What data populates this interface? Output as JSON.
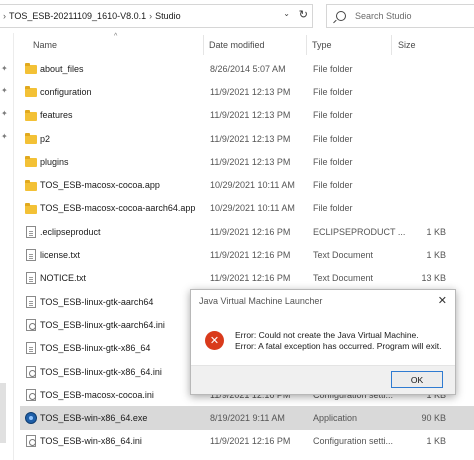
{
  "address": {
    "crumbs": [
      "TOS_ESB-20211109_1610-V8.0.1",
      "Studio"
    ],
    "search_placeholder": "Search Studio"
  },
  "columns": {
    "name": "Name",
    "date": "Date modified",
    "type": "Type",
    "size": "Size"
  },
  "files": [
    {
      "name": "about_files",
      "date": "8/26/2014 5:07 AM",
      "type": "File folder",
      "size": "",
      "icon": "folder"
    },
    {
      "name": "configuration",
      "date": "11/9/2021 12:13 PM",
      "type": "File folder",
      "size": "",
      "icon": "folder"
    },
    {
      "name": "features",
      "date": "11/9/2021 12:13 PM",
      "type": "File folder",
      "size": "",
      "icon": "folder"
    },
    {
      "name": "p2",
      "date": "11/9/2021 12:13 PM",
      "type": "File folder",
      "size": "",
      "icon": "folder"
    },
    {
      "name": "plugins",
      "date": "11/9/2021 12:13 PM",
      "type": "File folder",
      "size": "",
      "icon": "folder"
    },
    {
      "name": "TOS_ESB-macosx-cocoa.app",
      "date": "10/29/2021 10:11 AM",
      "type": "File folder",
      "size": "",
      "icon": "folder"
    },
    {
      "name": "TOS_ESB-macosx-cocoa-aarch64.app",
      "date": "10/29/2021 10:11 AM",
      "type": "File folder",
      "size": "",
      "icon": "folder"
    },
    {
      "name": ".eclipseproduct",
      "date": "11/9/2021 12:16 PM",
      "type": "ECLIPSEPRODUCT ...",
      "size": "1 KB",
      "icon": "file"
    },
    {
      "name": "license.txt",
      "date": "11/9/2021 12:16 PM",
      "type": "Text Document",
      "size": "1 KB",
      "icon": "file"
    },
    {
      "name": "NOTICE.txt",
      "date": "11/9/2021 12:16 PM",
      "type": "Text Document",
      "size": "13 KB",
      "icon": "file"
    },
    {
      "name": "TOS_ESB-linux-gtk-aarch64",
      "date": "",
      "type": "",
      "size": "",
      "icon": "file"
    },
    {
      "name": "TOS_ESB-linux-gtk-aarch64.ini",
      "date": "",
      "type": "",
      "size": "",
      "icon": "ini"
    },
    {
      "name": "TOS_ESB-linux-gtk-x86_64",
      "date": "",
      "type": "",
      "size": "",
      "icon": "file"
    },
    {
      "name": "TOS_ESB-linux-gtk-x86_64.ini",
      "date": "",
      "type": "",
      "size": "",
      "icon": "ini"
    },
    {
      "name": "TOS_ESB-macosx-cocoa.ini",
      "date": "11/9/2021 12:16 PM",
      "type": "Configuration setti...",
      "size": "1 KB",
      "icon": "ini"
    },
    {
      "name": "TOS_ESB-win-x86_64.exe",
      "date": "8/19/2021 9:11 AM",
      "type": "Application",
      "size": "90 KB",
      "icon": "exe",
      "selected": true
    },
    {
      "name": "TOS_ESB-win-x86_64.ini",
      "date": "11/9/2021 12:16 PM",
      "type": "Configuration setti...",
      "size": "1 KB",
      "icon": "ini"
    }
  ],
  "dialog": {
    "title": "Java Virtual Machine Launcher",
    "line1": "Error: Could not create the Java Virtual Machine.",
    "line2": "Error: A fatal exception has occurred. Program will exit.",
    "ok_label": "OK"
  }
}
